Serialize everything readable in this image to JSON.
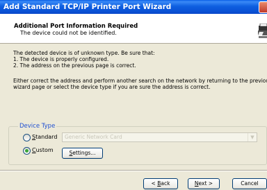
{
  "window": {
    "title": "Add Standard TCP/IP Printer Port Wizard"
  },
  "header": {
    "title": "Additional Port Information Required",
    "subtitle": "The device could not be identified."
  },
  "body": {
    "intro": "The detected device is of unknown type.  Be sure that:",
    "item1": "1. The device is properly configured.",
    "item2": "2. The address on the previous page is correct.",
    "either1": "Either correct the address and perform another search on the network by returning to the previous",
    "either2": "wizard page or select the device type if you are sure the address is correct."
  },
  "device_type": {
    "label": "Device Type",
    "standard_label": "Standard",
    "custom_label": "Custom",
    "selected": "Custom",
    "combo_value": "Generic Network Card",
    "settings_label": "Settings..."
  },
  "footer": {
    "back_label": "< Back",
    "next_label": "Next >",
    "cancel_label": "Cancel"
  }
}
